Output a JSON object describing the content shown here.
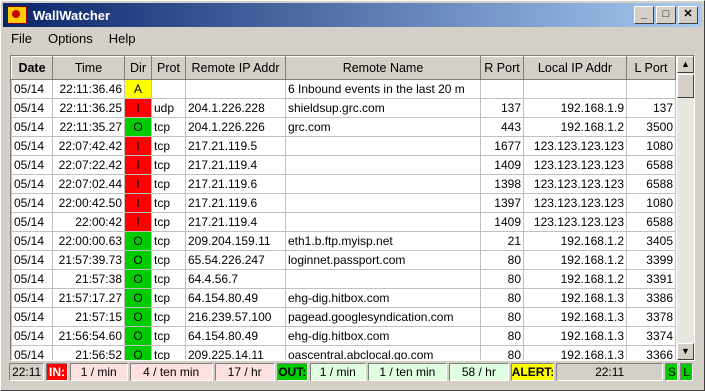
{
  "app": {
    "title": "WallWatcher"
  },
  "titlebar": {
    "minimize": "_",
    "maximize": "□",
    "close": "✕"
  },
  "menu": [
    {
      "label": "File"
    },
    {
      "label": "Options"
    },
    {
      "label": "Help"
    }
  ],
  "columns": [
    "Date",
    "Time",
    "Dir",
    "Prot",
    "Remote IP Addr",
    "Remote Name",
    "R Port",
    "Local IP Addr",
    "L Port"
  ],
  "rows": [
    {
      "date": "05/14",
      "time": "22:11:36.46",
      "dir": "A",
      "prot": "",
      "rip": "",
      "rname": "6 Inbound events in the last 20 m",
      "rport": "",
      "lip": "",
      "lport": ""
    },
    {
      "date": "05/14",
      "time": "22:11:36.25",
      "dir": "I",
      "prot": "udp",
      "rip": "204.1.226.228",
      "rname": "shieldsup.grc.com",
      "rport": "137",
      "lip": "192.168.1.9",
      "lport": "137"
    },
    {
      "date": "05/14",
      "time": "22:11:35.27",
      "dir": "O",
      "prot": "tcp",
      "rip": "204.1.226.226",
      "rname": "grc.com",
      "rport": "443",
      "lip": "192.168.1.2",
      "lport": "3500"
    },
    {
      "date": "05/14",
      "time": "22:07:42.42",
      "dir": "I",
      "prot": "tcp",
      "rip": "217.21.119.5",
      "rname": "",
      "rport": "1677",
      "lip": "123.123.123.123",
      "lport": "1080"
    },
    {
      "date": "05/14",
      "time": "22:07:22.42",
      "dir": "I",
      "prot": "tcp",
      "rip": "217.21.119.4",
      "rname": "",
      "rport": "1409",
      "lip": "123.123.123.123",
      "lport": "6588"
    },
    {
      "date": "05/14",
      "time": "22:07:02.44",
      "dir": "I",
      "prot": "tcp",
      "rip": "217.21.119.6",
      "rname": "",
      "rport": "1398",
      "lip": "123.123.123.123",
      "lport": "6588"
    },
    {
      "date": "05/14",
      "time": "22:00:42.50",
      "dir": "I",
      "prot": "tcp",
      "rip": "217.21.119.6",
      "rname": "",
      "rport": "1397",
      "lip": "123.123.123.123",
      "lport": "1080"
    },
    {
      "date": "05/14",
      "time": "22:00:42",
      "dir": "I",
      "prot": "tcp",
      "rip": "217.21.119.4",
      "rname": "",
      "rport": "1409",
      "lip": "123.123.123.123",
      "lport": "6588"
    },
    {
      "date": "05/14",
      "time": "22:00:00.63",
      "dir": "O",
      "prot": "tcp",
      "rip": "209.204.159.11",
      "rname": "eth1.b.ftp.myisp.net",
      "rport": "21",
      "lip": "192.168.1.2",
      "lport": "3405"
    },
    {
      "date": "05/14",
      "time": "21:57:39.73",
      "dir": "O",
      "prot": "tcp",
      "rip": "65.54.226.247",
      "rname": "loginnet.passport.com",
      "rport": "80",
      "lip": "192.168.1.2",
      "lport": "3399"
    },
    {
      "date": "05/14",
      "time": "21:57:38",
      "dir": "O",
      "prot": "tcp",
      "rip": "64.4.56.7",
      "rname": "",
      "rport": "80",
      "lip": "192.168.1.2",
      "lport": "3391"
    },
    {
      "date": "05/14",
      "time": "21:57:17.27",
      "dir": "O",
      "prot": "tcp",
      "rip": "64.154.80.49",
      "rname": "ehg-dig.hitbox.com",
      "rport": "80",
      "lip": "192.168.1.3",
      "lport": "3386"
    },
    {
      "date": "05/14",
      "time": "21:57:15",
      "dir": "O",
      "prot": "tcp",
      "rip": "216.239.57.100",
      "rname": "pagead.googlesyndication.com",
      "rport": "80",
      "lip": "192.168.1.3",
      "lport": "3378"
    },
    {
      "date": "05/14",
      "time": "21:56:54.60",
      "dir": "O",
      "prot": "tcp",
      "rip": "64.154.80.49",
      "rname": "ehg-dig.hitbox.com",
      "rport": "80",
      "lip": "192.168.1.3",
      "lport": "3374"
    },
    {
      "date": "05/14",
      "time": "21:56:52",
      "dir": "O",
      "prot": "tcp",
      "rip": "209.225.14.11",
      "rname": "oascentral.abclocal.go.com",
      "rport": "80",
      "lip": "192.168.1.3",
      "lport": "3366"
    }
  ],
  "scroll": {
    "up": "▲",
    "down": "▼"
  },
  "status": [
    {
      "name": "status-clock",
      "text": "22:11",
      "bg": "#d4d0c8",
      "fg": "#000",
      "w": 34,
      "bold": false
    },
    {
      "name": "status-in-label",
      "text": "IN:",
      "bg": "#ff0000",
      "fg": "#fff",
      "w": 20,
      "bold": true
    },
    {
      "name": "status-in-per-min",
      "text": "1 / min",
      "bg": "#ffe0e0",
      "fg": "#000",
      "w": 57,
      "bold": false
    },
    {
      "name": "status-in-per-ten-min",
      "text": "4 / ten min",
      "bg": "#ffe0e0",
      "fg": "#000",
      "w": 83,
      "bold": false
    },
    {
      "name": "status-in-per-hr",
      "text": "17 / hr",
      "bg": "#ffe0e0",
      "fg": "#000",
      "w": 59,
      "bold": false
    },
    {
      "name": "status-out-label",
      "text": "OUT:",
      "bg": "#00cc00",
      "fg": "#000",
      "w": 30,
      "bold": true
    },
    {
      "name": "status-out-per-min",
      "text": "1 / min",
      "bg": "#e0ffe0",
      "fg": "#000",
      "w": 55,
      "bold": false
    },
    {
      "name": "status-out-per-ten-min",
      "text": "1 / ten min",
      "bg": "#e0ffe0",
      "fg": "#000",
      "w": 79,
      "bold": false
    },
    {
      "name": "status-out-per-hr",
      "text": "58 / hr",
      "bg": "#e0ffe0",
      "fg": "#000",
      "w": 59,
      "bold": false
    },
    {
      "name": "status-alert-label",
      "text": "ALERT:",
      "bg": "#ffff00",
      "fg": "#000",
      "w": 42,
      "bold": true
    },
    {
      "name": "status-alert-time",
      "text": "22:11",
      "bg": "#d4d0c8",
      "fg": "#000",
      "w": 108,
      "bold": false
    },
    {
      "name": "status-s-indicator",
      "text": "S",
      "bg": "#00cc00",
      "fg": "#000",
      "w": 11,
      "bold": false
    },
    {
      "name": "status-l-indicator",
      "text": "L",
      "bg": "#00cc00",
      "fg": "#000",
      "w": 11,
      "bold": false
    }
  ]
}
